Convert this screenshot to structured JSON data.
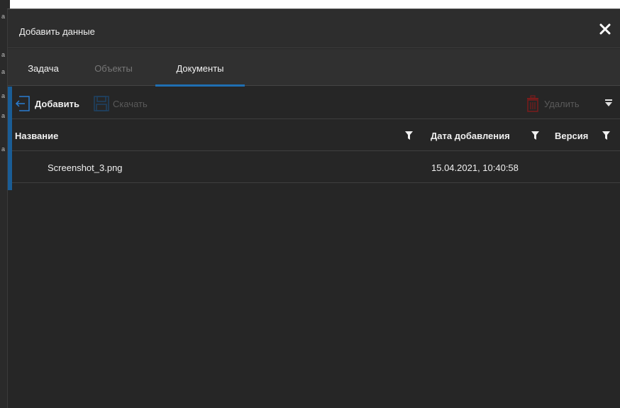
{
  "dialog": {
    "title": "Добавить данные",
    "close_icon": "close-icon"
  },
  "tabs": [
    {
      "label": "Задача",
      "state": "normal"
    },
    {
      "label": "Объекты",
      "state": "disabled"
    },
    {
      "label": "Документы",
      "state": "active"
    }
  ],
  "toolbar": {
    "add_label": "Добавить",
    "add_icon": "add-document-icon",
    "download_label": "Скачать",
    "download_icon": "save-icon",
    "delete_label": "Удалить",
    "delete_icon": "trash-icon",
    "menu_icon": "menu-chevron-icon"
  },
  "grid": {
    "columns": [
      "Название",
      "Дата добавления",
      "Версия"
    ],
    "rows": [
      {
        "name": "Screenshot_3.png",
        "date": "15.04.2021, 10:40:58",
        "version": ""
      }
    ]
  },
  "colors": {
    "accent": "#1f6fb2",
    "background": "#262626",
    "titlebar": "#2d2d2d",
    "delete_icon": "#7a1c1c"
  }
}
